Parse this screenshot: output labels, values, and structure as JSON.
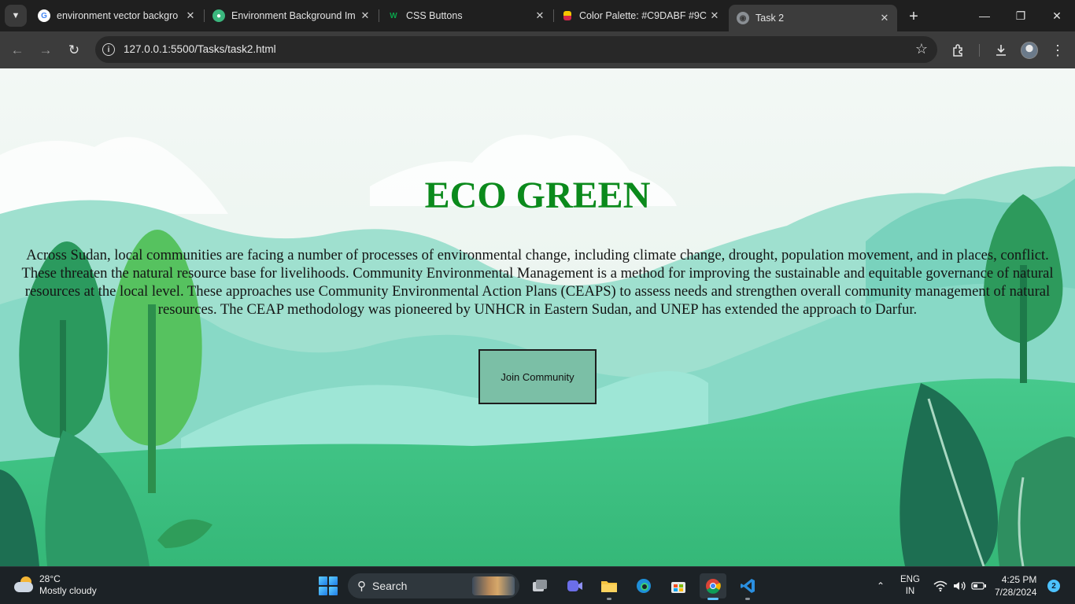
{
  "browser": {
    "tabs": [
      {
        "title": "environment vector backgro",
        "favicon": "google-icon",
        "active": false
      },
      {
        "title": "Environment Background Im",
        "favicon": "earth-icon",
        "active": false
      },
      {
        "title": "CSS Buttons",
        "favicon": "w-logo-icon",
        "active": false
      },
      {
        "title": "Color Palette: #C9DABF #9C",
        "favicon": "palette-icon",
        "active": false
      },
      {
        "title": "Task 2",
        "favicon": "globe-icon",
        "active": true
      }
    ],
    "address": {
      "url": "127.0.0.1:5500/Tasks/task2.html"
    },
    "icons": {
      "back": "←",
      "forward": "→",
      "reload": "↻",
      "star": "☆",
      "new_tab": "+",
      "minimize": "—",
      "restore": "❐",
      "close": "✕",
      "menu": "⋮",
      "tab_close": "✕",
      "tab_search": "⌄"
    }
  },
  "page": {
    "title": "ECO GREEN",
    "paragraph": "Across Sudan, local communities are facing a number of processes of environmental change, including climate change, drought, population movement, and in places, conflict. These threaten the natural resource base for livelihoods. Community Environmental Management is a method for improving the sustainable and equitable governance of natural resources at the local level. These approaches use Community Environmental Action Plans (CEAPS) to assess needs and strengthen overall community management of natural resources. The CEAP methodology was pioneered by UNHCR in Eastern Sudan, and UNEP has extended the approach to Darfur.",
    "button_label": "Join Community",
    "colors": {
      "title": "#0b8a1c",
      "button_bg": "#7bbfa6",
      "hills_light": "#a9e3d3",
      "grass": "#3fc486",
      "tree_dark": "#1d7a55"
    }
  },
  "taskbar": {
    "weather": {
      "temp": "28°C",
      "condition": "Mostly cloudy"
    },
    "search_label": "Search",
    "apps": [
      "task-view-icon",
      "meet-icon",
      "file-explorer-icon",
      "edge-icon",
      "store-icon",
      "chrome-icon",
      "vscode-icon"
    ],
    "language": {
      "line1": "ENG",
      "line2": "IN"
    },
    "clock": {
      "time": "4:25 PM",
      "date": "7/28/2024"
    },
    "notifications": "2"
  }
}
